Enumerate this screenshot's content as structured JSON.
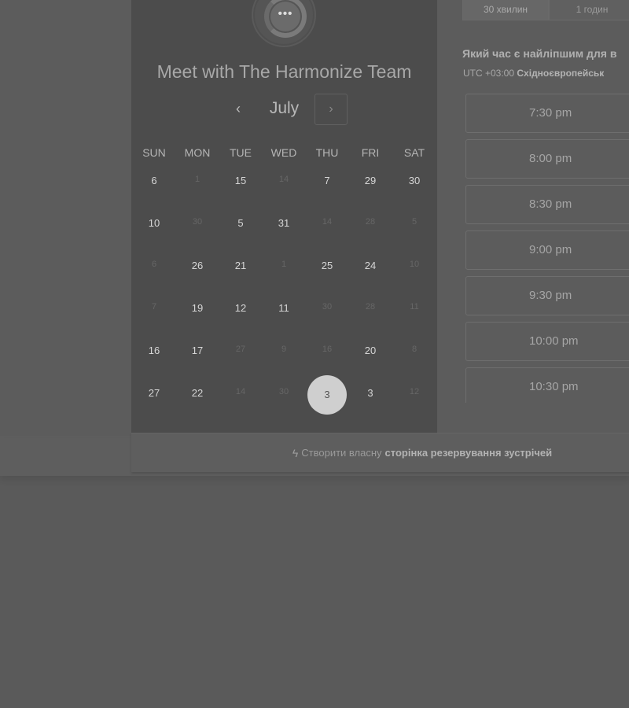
{
  "calendar": {
    "title": "Meet with The Harmonize Team",
    "month": "July",
    "prev_glyph": "‹",
    "next_glyph": "›",
    "logo_dots": "•••",
    "weekdays": [
      "SUN",
      "MON",
      "TUE",
      "WED",
      "THU",
      "FRI",
      "SAT"
    ],
    "weeks": [
      [
        {
          "t": "6"
        },
        {
          "t": "1",
          "dim": true
        },
        {
          "t": "15"
        },
        {
          "t": "14",
          "dim": true
        },
        {
          "t": "7"
        },
        {
          "t": "29"
        },
        {
          "t": "30"
        }
      ],
      [
        {
          "t": "10"
        },
        {
          "t": "30",
          "dim": true
        },
        {
          "t": "5"
        },
        {
          "t": "31"
        },
        {
          "t": "14",
          "dim": true
        },
        {
          "t": "28",
          "dim": true
        },
        {
          "t": "5",
          "dim": true
        }
      ],
      [
        {
          "t": "6",
          "dim": true
        },
        {
          "t": "26"
        },
        {
          "t": "21"
        },
        {
          "t": "1",
          "dim": true
        },
        {
          "t": "25"
        },
        {
          "t": "24"
        },
        {
          "t": "10",
          "dim": true
        }
      ],
      [
        {
          "t": "7",
          "dim": true
        },
        {
          "t": "19"
        },
        {
          "t": "12"
        },
        {
          "t": "11"
        },
        {
          "t": "30",
          "dim": true
        },
        {
          "t": "28",
          "dim": true
        },
        {
          "t": "11",
          "dim": true
        }
      ],
      [
        {
          "t": "16"
        },
        {
          "t": "17"
        },
        {
          "t": "27",
          "dim": true
        },
        {
          "t": "9",
          "dim": true
        },
        {
          "t": "16",
          "dim": true
        },
        {
          "t": "20"
        },
        {
          "t": "8",
          "dim": true
        }
      ],
      [
        {
          "t": "27"
        },
        {
          "t": "22"
        },
        {
          "t": "14",
          "dim": true
        },
        {
          "t": "30",
          "dim": true
        },
        {
          "t": "3",
          "selected": true
        },
        {
          "t": "3"
        },
        {
          "t": "12",
          "dim": true
        }
      ]
    ]
  },
  "durations": [
    "30 хвилин",
    "1 годин"
  ],
  "right": {
    "question": "Який час є найліпшим для в",
    "timezone_prefix": "UTC +03:00",
    "timezone_name": "Східноєвропейськ"
  },
  "slots": [
    "7:30 pm",
    "8:00 pm",
    "8:30 pm",
    "9:00 pm",
    "9:30 pm",
    "10:00 pm",
    "10:30 pm"
  ],
  "footer": {
    "glyph": "ϟ",
    "text": "Створити власну",
    "bold": "сторінка резервування зустрічей"
  }
}
